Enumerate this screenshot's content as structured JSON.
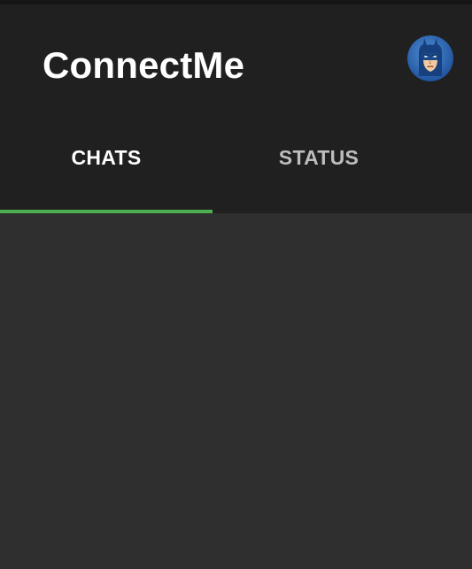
{
  "app": {
    "title": "ConnectMe"
  },
  "tabs": [
    {
      "label": "CHATS",
      "active": true
    },
    {
      "label": "STATUS",
      "active": false
    }
  ],
  "colors": {
    "app_bar": "#202020",
    "background": "#2f2f2f",
    "accent": "#4caf50",
    "tab_active_text": "#ffffff",
    "tab_inactive_text": "#bdbdbd"
  },
  "avatar": {
    "icon": "batman-avatar-icon"
  }
}
